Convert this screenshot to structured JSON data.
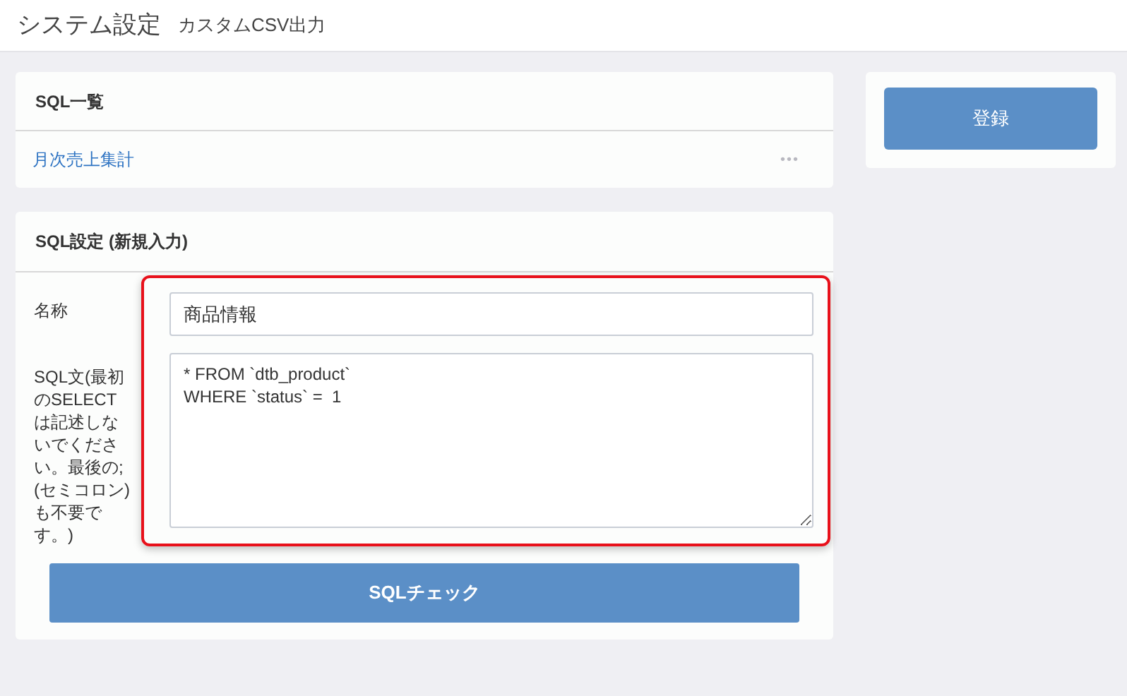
{
  "header": {
    "title": "システム設定",
    "subtitle": "カスタムCSV出力"
  },
  "sql_list": {
    "title": "SQL一覧",
    "items": [
      {
        "name": "月次売上集計",
        "menu": "•••"
      }
    ]
  },
  "sql_settings": {
    "title": "SQL設定 (新規入力)",
    "name_field": {
      "label": "名称",
      "value": "商品情報"
    },
    "sql_field": {
      "label": "SQL文(最初のSELECTは記述しないでください。最後の;(セミコロン)も不要です。)",
      "value": "* FROM `dtb_product`\nWHERE `status` =  1"
    },
    "check_button": "SQLチェック"
  },
  "register_button": "登録"
}
